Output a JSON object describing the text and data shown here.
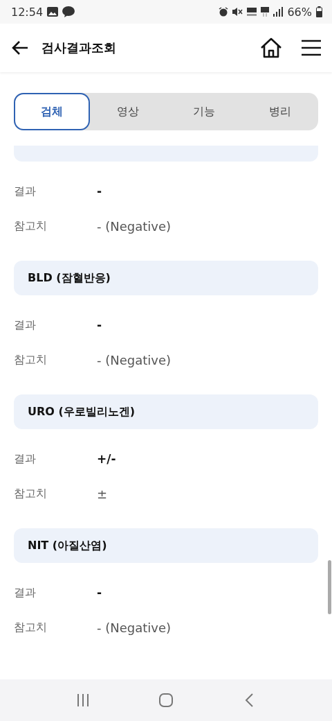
{
  "status_bar": {
    "time": "12:54",
    "battery": "66%"
  },
  "header": {
    "title": "검사결과조회"
  },
  "tabs": [
    {
      "label": "검체",
      "selected": true
    },
    {
      "label": "영상",
      "selected": false
    },
    {
      "label": "기능",
      "selected": false
    },
    {
      "label": "병리",
      "selected": false
    }
  ],
  "sections": [
    {
      "rows": [
        {
          "label": "결과",
          "value": "-",
          "kind": "result"
        },
        {
          "label": "참고치",
          "value": "- (Negative)",
          "kind": "reference"
        }
      ]
    },
    {
      "title": "BLD (잠혈반응)",
      "rows": [
        {
          "label": "결과",
          "value": "-",
          "kind": "result"
        },
        {
          "label": "참고치",
          "value": "- (Negative)",
          "kind": "reference"
        }
      ]
    },
    {
      "title": "URO (우로빌리노겐)",
      "rows": [
        {
          "label": "결과",
          "value": "+/-",
          "kind": "result"
        },
        {
          "label": "참고치",
          "value": "±",
          "kind": "reference"
        }
      ]
    },
    {
      "title": "NIT (아질산염)",
      "rows": [
        {
          "label": "결과",
          "value": "-",
          "kind": "result"
        },
        {
          "label": "참고치",
          "value": "- (Negative)",
          "kind": "reference"
        }
      ]
    }
  ]
}
